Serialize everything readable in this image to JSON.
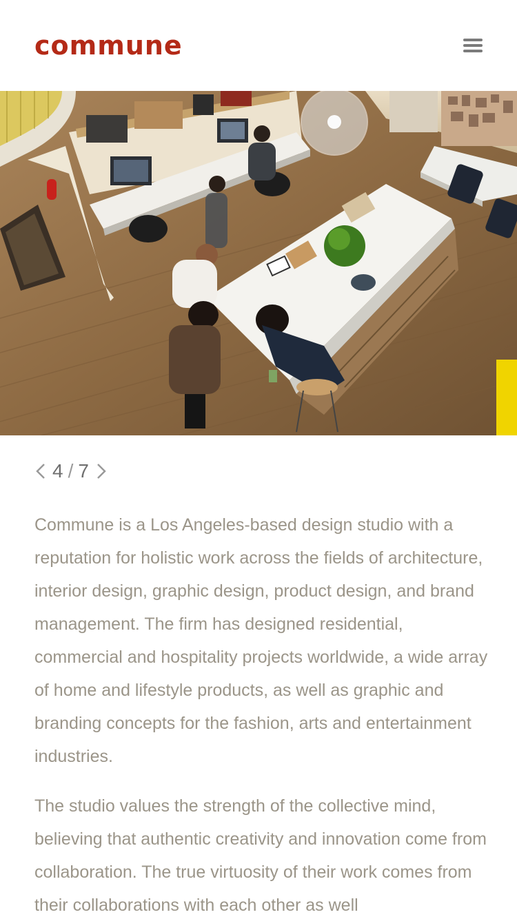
{
  "header": {
    "logo_text": "commune",
    "menu_icon": "hamburger-icon",
    "brand_color": "#b42a17"
  },
  "hero": {
    "image_description_icon": "office-photo"
  },
  "slider": {
    "current": "4",
    "total": "7",
    "separator": "/",
    "prev_icon": "chevron-left-icon",
    "next_icon": "chevron-right-icon"
  },
  "content": {
    "paragraphs": [
      "Commune is a Los Angeles-based design studio with a reputation for holistic work across the fields of architecture, interior design, graphic design, product design, and brand management. The firm has designed residential, commercial and hospitality projects worldwide, a wide array of home and lifestyle products, as well as graphic and branding concepts for the fashion, arts and entertainment industries.",
      "The studio values the strength of the collective mind, believing that authentic creativity and innovation come from collaboration. The true virtuosity of their work comes from their collaborations with each other as well"
    ],
    "text_color": "#9b9589"
  }
}
